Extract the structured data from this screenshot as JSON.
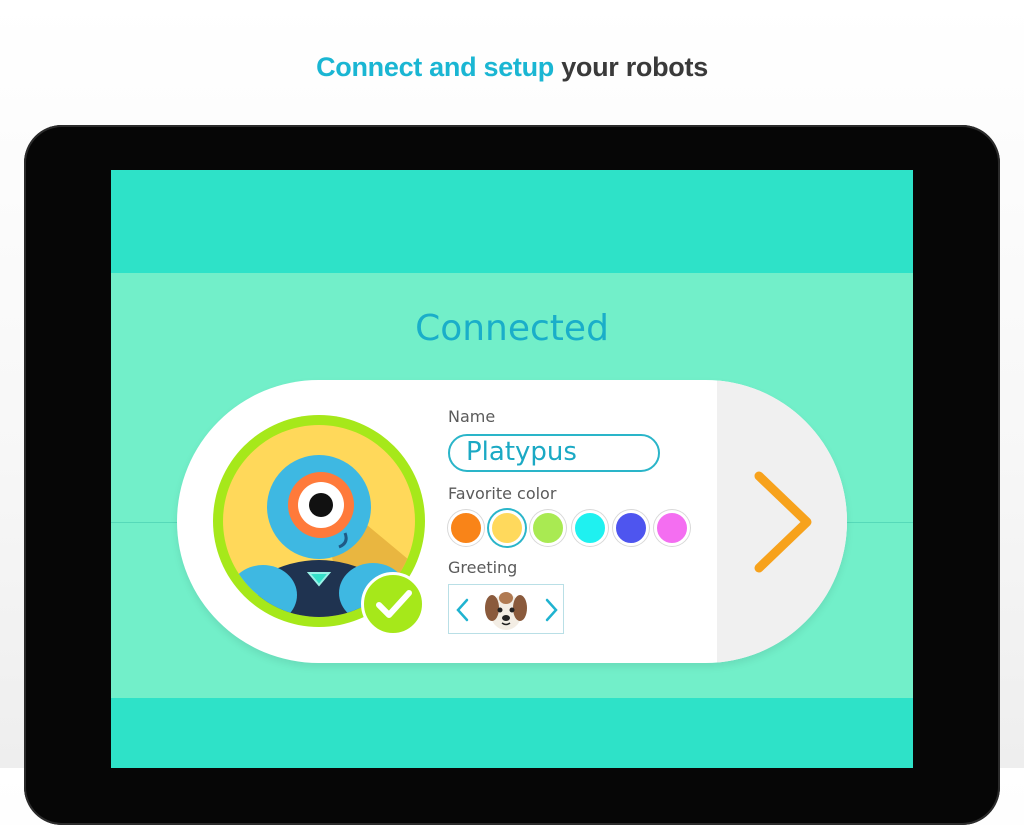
{
  "header": {
    "accent_text": "Connect and setup",
    "rest_text": "your robots",
    "accent_color": "#1ab6d3"
  },
  "screen": {
    "status_title": "Connected"
  },
  "robot_card": {
    "name_label": "Name",
    "name_value": "Platypus",
    "color_label": "Favorite color",
    "colors": [
      "#f98418",
      "#ffd95c",
      "#a9ea52",
      "#1ff1f0",
      "#4e55ef",
      "#f46ef1"
    ],
    "selected_color_index": 1,
    "greeting_label": "Greeting",
    "greeting_icon": "dog-face-icon",
    "connected_icon": "checkmark-icon",
    "next_icon": "chevron-right-icon",
    "next_color": "#f7a21c"
  }
}
